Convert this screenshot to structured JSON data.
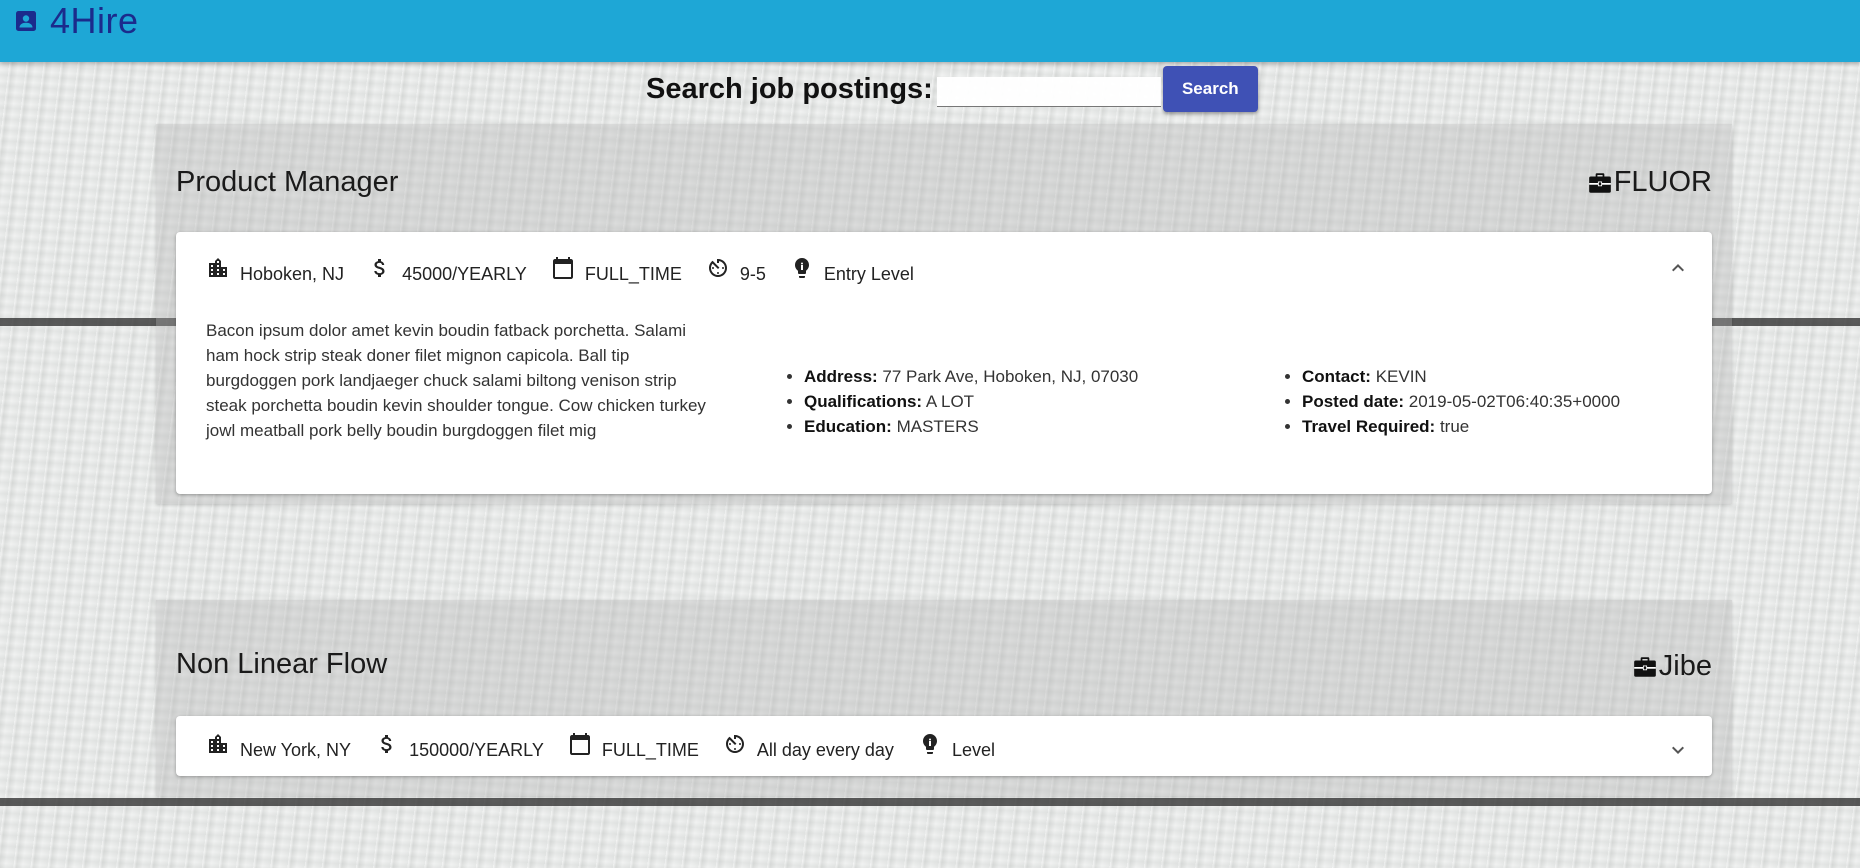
{
  "app": {
    "title": "4Hire"
  },
  "search": {
    "label": "Search job postings:",
    "value": "",
    "button": "Search"
  },
  "jobs": [
    {
      "title": "Product Manager",
      "company": "FLUOR",
      "location": "Hoboken, NJ",
      "salary": "45000/YEARLY",
      "type": "FULL_TIME",
      "hours": "9-5",
      "level": "Entry Level",
      "expanded": true,
      "description": "Bacon ipsum dolor amet kevin boudin fatback porchetta. Salami ham hock strip steak doner filet mignon capicola. Ball tip burgdoggen pork landjaeger chuck salami biltong venison strip steak porchetta boudin kevin shoulder tongue. Cow chicken turkey jowl meatball pork belly boudin burgdoggen filet mig",
      "details": {
        "address_label": "Address:",
        "address": "77 Park Ave, Hoboken, NJ, 07030",
        "qualifications_label": "Qualifications:",
        "qualifications": "A LOT",
        "education_label": "Education:",
        "education": "MASTERS",
        "contact_label": "Contact:",
        "contact": "KEVIN",
        "posted_label": "Posted date:",
        "posted": "2019-05-02T06:40:35+0000",
        "travel_label": "Travel Required:",
        "travel": "true"
      }
    },
    {
      "title": "Non Linear Flow",
      "company": "Jibe",
      "location": "New York, NY",
      "salary": "150000/YEARLY",
      "type": "FULL_TIME",
      "hours": "All day every day",
      "level": "Level",
      "expanded": false
    }
  ],
  "icons": {
    "brand": "contact-card-icon",
    "company": "briefcase-icon",
    "location": "city-buildings-icon",
    "salary": "dollar-icon",
    "type": "calendar-icon",
    "hours": "timer-icon",
    "level": "lightbulb-icon",
    "collapse": "chevron-up-icon",
    "expand": "chevron-down-icon"
  },
  "colors": {
    "appbar": "#1ea7d6",
    "brand": "#1b2b8c",
    "button": "#3f51b5"
  }
}
